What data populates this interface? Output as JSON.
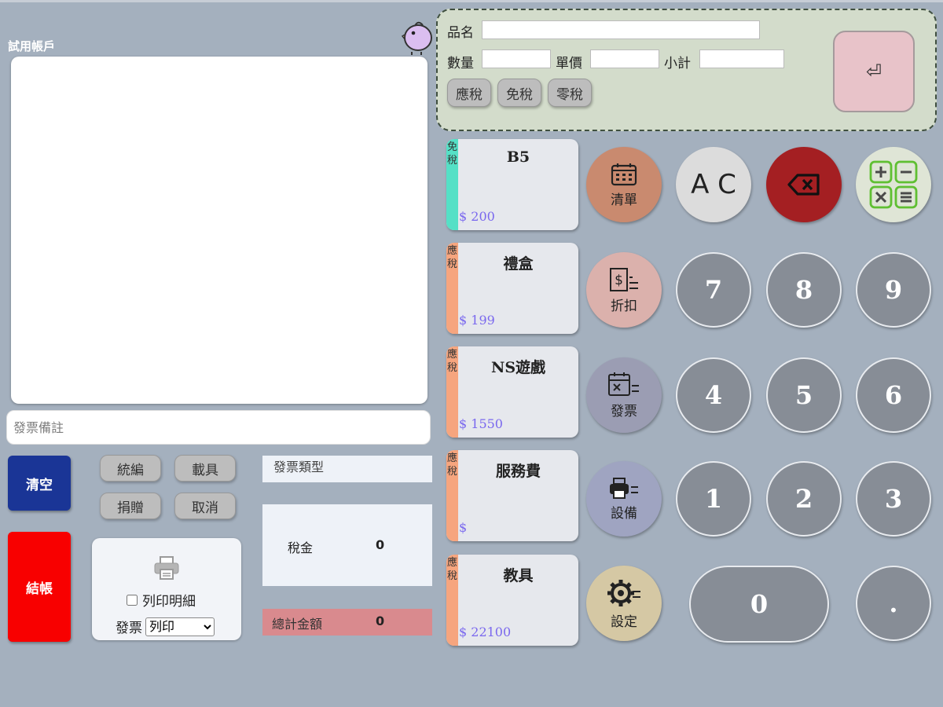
{
  "account": {
    "label": "試用帳戶"
  },
  "note": {
    "placeholder": "發票備註"
  },
  "left_buttons": {
    "clear": "清空",
    "checkout": "結帳"
  },
  "small_buttons": {
    "tax_id": "統編",
    "carrier": "載具",
    "donate": "捐贈",
    "cancel": "取消"
  },
  "print_panel": {
    "detail_label": "列印明細",
    "invoice_label": "發票",
    "invoice_option": "列印"
  },
  "summary": {
    "invoice_type": "發票類型",
    "tax_label": "稅金",
    "tax_value": "0",
    "total_label": "總計金額",
    "total_value": "0"
  },
  "input_panel": {
    "name_label": "品名",
    "qty_label": "數量",
    "price_label": "單價",
    "subtotal_label": "小計",
    "tax_buttons": [
      "應稅",
      "免稅",
      "零稅"
    ],
    "enter_symbol": "⏎"
  },
  "products": [
    {
      "tax": "免稅",
      "name": "B5",
      "price": "$ 200",
      "strip_color": "#55e0c6"
    },
    {
      "tax": "應稅",
      "name": "禮盒",
      "price": "$ 199",
      "strip_color": "#f6a57e"
    },
    {
      "tax": "應稅",
      "name": "NS遊戲",
      "price": "$ 1550",
      "strip_color": "#f6a57e"
    },
    {
      "tax": "應稅",
      "name": "服務費",
      "price": "$",
      "strip_color": "#f6a57e"
    },
    {
      "tax": "應稅",
      "name": "教具",
      "price": "$ 22100",
      "strip_color": "#f6a57e"
    }
  ],
  "functions": {
    "list": {
      "label": "清單",
      "color": "#c98a6f",
      "icon": "calendar-icon"
    },
    "discount": {
      "label": "折扣",
      "color": "#dbb1ac",
      "icon": "dollar-list-icon"
    },
    "invoice": {
      "label": "發票",
      "color": "#9b9db3",
      "icon": "invoice-list-icon"
    },
    "device": {
      "label": "設備",
      "color": "#9fa4c1",
      "icon": "printer-list-icon"
    },
    "settings": {
      "label": "設定",
      "color": "#d5c8a4",
      "icon": "gear-list-icon"
    }
  },
  "keypad": {
    "ac": "A C",
    "backspace_color": "#a41f22",
    "calc_color": "#dfe5d6",
    "keys": {
      "k7": "7",
      "k8": "8",
      "k9": "9",
      "k4": "4",
      "k5": "5",
      "k6": "6",
      "k1": "1",
      "k2": "2",
      "k3": "3",
      "k0": "0",
      "dot": "."
    }
  }
}
